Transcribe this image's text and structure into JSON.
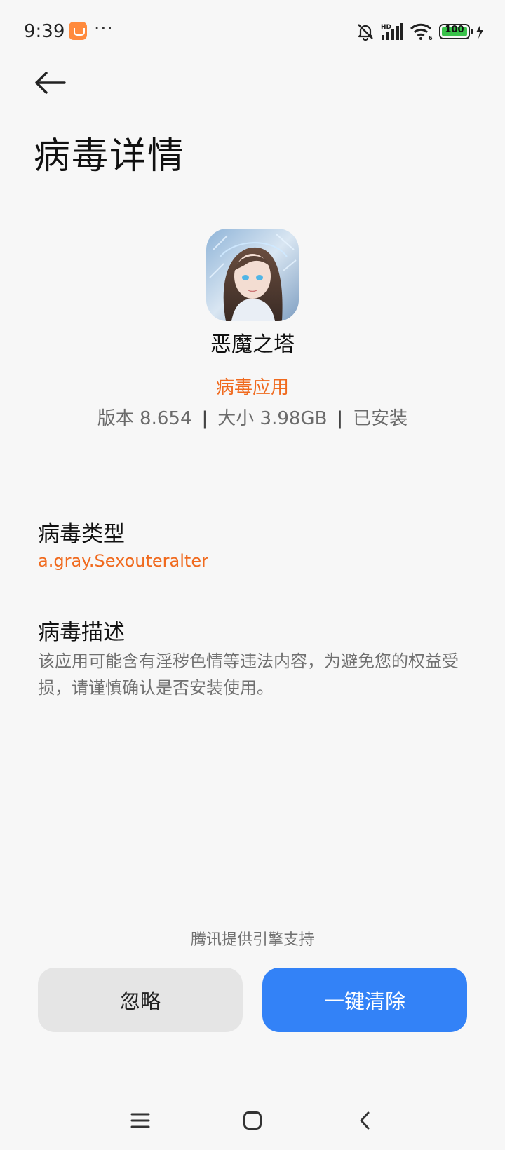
{
  "status_bar": {
    "time": "9:39",
    "more": "···",
    "signal_tag": "HD",
    "wifi_tag": "6",
    "battery": "100"
  },
  "header": {
    "title": "病毒详情"
  },
  "app": {
    "name": "恶魔之塔",
    "status": "病毒应用",
    "version": "版本 8.654",
    "size": "大小 3.98GB",
    "install_state": "已安装"
  },
  "virus_type": {
    "label": "病毒类型",
    "value": "a.gray.Sexouteralter"
  },
  "virus_desc": {
    "label": "病毒描述",
    "text": "该应用可能含有淫秽色情等违法内容，为避免您的权益受损，请谨慎确认是否安装使用。"
  },
  "footer": {
    "engine_note": "腾讯提供引擎支持",
    "ignore_label": "忽略",
    "clean_label": "一键清除"
  },
  "colors": {
    "accent_orange": "#f06a1e",
    "primary_blue": "#3382f7",
    "background": "#f7f7f7",
    "battery_green": "#39c24a"
  },
  "icons": [
    "back-arrow-icon",
    "mute-bell-icon",
    "signal-icon",
    "wifi-icon",
    "battery-icon",
    "charging-icon",
    "menu-icon",
    "home-icon",
    "back-icon"
  ]
}
